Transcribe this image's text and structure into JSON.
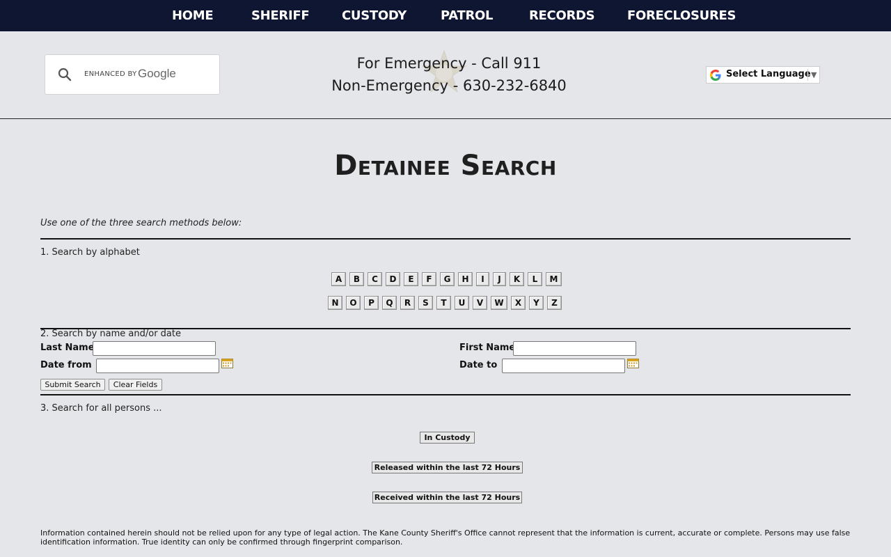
{
  "nav": {
    "items": [
      "HOME",
      "SHERIFF",
      "CUSTODY",
      "PATROL",
      "RECORDS",
      "FORECLOSURES"
    ]
  },
  "header": {
    "search": {
      "enhanced_by": "ENHANCED BY",
      "google": "Google",
      "icon": "search-icon"
    },
    "emergency_line": "For Emergency - Call 911",
    "non_emergency_line": "Non-Emergency - 630-232-6840",
    "language_label": "Select Language"
  },
  "page": {
    "title": "Detainee Search",
    "intro": "Use one of the three search methods below:"
  },
  "section1": {
    "label": "1. Search by alphabet",
    "row1": [
      "A",
      "B",
      "C",
      "D",
      "E",
      "F",
      "G",
      "H",
      "I",
      "J",
      "K",
      "L",
      "M"
    ],
    "row2": [
      "N",
      "O",
      "P",
      "Q",
      "R",
      "S",
      "T",
      "U",
      "V",
      "W",
      "X",
      "Y",
      "Z"
    ]
  },
  "section2": {
    "label": "2. Search by name and/or date",
    "last_name_label": "Last Name",
    "first_name_label": "First Name",
    "date_from_label": "Date from",
    "date_to_label": "Date to",
    "last_name_value": "",
    "first_name_value": "",
    "date_from_value": "",
    "date_to_value": "",
    "submit_label": "Submit Search",
    "clear_label": "Clear Fields"
  },
  "section3": {
    "label": "3. Search for all persons ...",
    "in_custody": "In Custody",
    "released": "Released within the last 72 Hours",
    "received": "Received within the last 72 Hours"
  },
  "disclaimer": "Information contained herein should not be relied upon for any type of legal action.  The Kane County Sheriff's Office cannot represent that the information is current, accurate or complete.  Persons may use false identification information.  True identity can only be confirmed through fingerprint comparison.",
  "colors": {
    "nav_bg": "#0f1631",
    "page_bg": "#e4e6e9"
  }
}
